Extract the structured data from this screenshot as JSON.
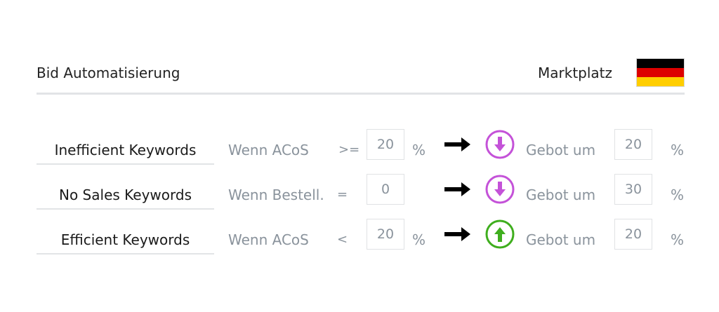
{
  "header": {
    "title": "Bid Automatisierung",
    "marketplace_label": "Marktplatz",
    "flag_icon": "germany-flag-icon"
  },
  "colors": {
    "decrease": "#c452d8",
    "increase": "#3fae1e",
    "flag": [
      "#000000",
      "#dd0000",
      "#ffce00"
    ]
  },
  "rules": [
    {
      "keyword": "Inefficient Keywords",
      "condition": "Wenn ACoS",
      "operator": ">=",
      "value": "20",
      "unit": "%",
      "direction": "decrease",
      "action": "Gebot um",
      "bid_value": "20",
      "bid_unit": "%"
    },
    {
      "keyword": "No Sales Keywords",
      "condition": "Wenn Bestell.",
      "operator": "=",
      "value": "0",
      "unit": "",
      "direction": "decrease",
      "action": "Gebot um",
      "bid_value": "30",
      "bid_unit": "%"
    },
    {
      "keyword": "Efficient Keywords",
      "condition": "Wenn ACoS",
      "operator": "<",
      "value": "20",
      "unit": "%",
      "direction": "increase",
      "action": "Gebot um",
      "bid_value": "20",
      "bid_unit": "%"
    }
  ]
}
